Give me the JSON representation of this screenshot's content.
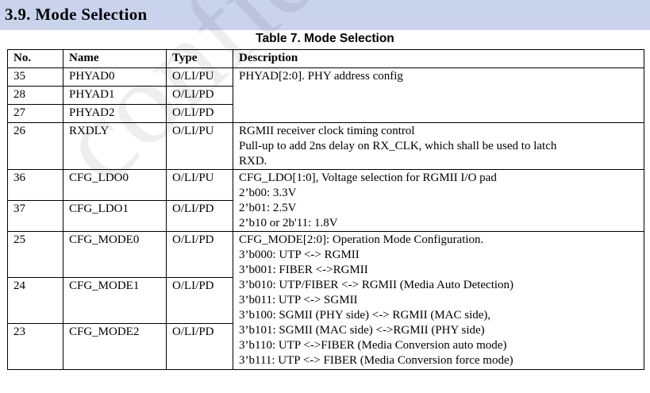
{
  "section": {
    "title": "3.9. Mode Selection"
  },
  "table": {
    "caption": "Table 7. Mode Selection",
    "headers": [
      "No.",
      "Name",
      "Type",
      "Description"
    ],
    "rows": [
      {
        "no": "35",
        "name": "PHYAD0",
        "type": "O/LI/PU"
      },
      {
        "no": "28",
        "name": "PHYAD1",
        "type": "O/LI/PD"
      },
      {
        "no": "27",
        "name": "PHYAD2",
        "type": "O/LI/PD"
      },
      {
        "no": "26",
        "name": "RXDLY",
        "type": "O/LI/PU"
      },
      {
        "no": "36",
        "name": "CFG_LDO0",
        "type": "O/LI/PU"
      },
      {
        "no": "37",
        "name": "CFG_LDO1",
        "type": "O/LI/PD"
      },
      {
        "no": "25",
        "name": "CFG_MODE0",
        "type": "O/LI/PD"
      },
      {
        "no": "24",
        "name": "CFG_MODE1",
        "type": "O/LI/PD"
      },
      {
        "no": "23",
        "name": "CFG_MODE2",
        "type": "O/LI/PD"
      }
    ],
    "descriptions": {
      "phyad": [
        "PHYAD[2:0]. PHY address config"
      ],
      "rxdly": [
        "RGMII receiver clock timing control",
        "Pull-up to add 2ns delay on RX_CLK, which shall be used to latch",
        "RXD."
      ],
      "ldo": [
        "CFG_LDO[1:0], Voltage selection for RGMII I/O pad",
        "2’b00: 3.3V",
        "2’b01: 2.5V",
        "2’b10 or 2b'11: 1.8V"
      ],
      "mode": [
        "CFG_MODE[2:0]: Operation Mode Configuration.",
        "3’b000: UTP <-> RGMII",
        "3’b001: FIBER <->RGMII",
        "3’b010: UTP/FIBER <-> RGMII (Media Auto Detection)",
        "3’b011: UTP <-> SGMII",
        "3’b100: SGMII (PHY side) <-> RGMII (MAC side),",
        "3’b101: SGMII (MAC side) <->RGMII (PHY side)",
        "3’b110: UTP <->FIBER (Media Conversion auto mode)",
        "3’b111: UTP <-> FIBER (Media Conversion force mode)"
      ]
    }
  },
  "watermark": {
    "text": "confid"
  }
}
